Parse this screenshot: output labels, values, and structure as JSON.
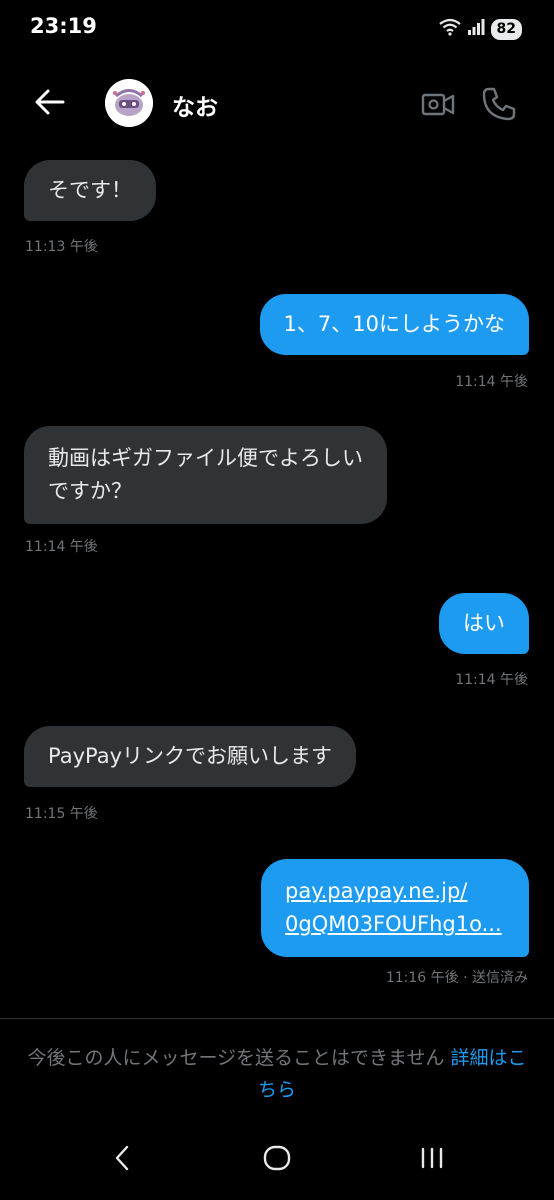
{
  "status_bar": {
    "time": "23:19",
    "battery": "82"
  },
  "header": {
    "contact_name": "なお"
  },
  "messages": [
    {
      "direction": "in",
      "text": "そです！",
      "time": "11:13 午後"
    },
    {
      "direction": "out",
      "text": "1、7、10にしようかな",
      "time": "11:14 午後"
    },
    {
      "direction": "in",
      "text_lines": [
        "動画はギガファイル便でよろしい",
        "ですか？"
      ],
      "time": "11:14 午後"
    },
    {
      "direction": "out",
      "text": "はい",
      "time": "11:14 午後"
    },
    {
      "direction": "in",
      "text": "PayPayリンクでお願いします",
      "time": "11:15 午後"
    },
    {
      "direction": "out",
      "link_lines": [
        "pay.paypay.ne.jp/",
        "0gQM03FOUFhg1o..."
      ],
      "time": "11:16 午後 · 送信済み"
    }
  ],
  "footer": {
    "notice_text": "今後この人にメッセージを送ることはできません",
    "notice_link": "詳細はこちら"
  },
  "colors": {
    "background": "#000000",
    "incoming_bubble": "#2f3336",
    "outgoing_bubble": "#1d9bf0",
    "timestamp": "#71767b",
    "accent": "#1d9bf0"
  },
  "icons": [
    "back-arrow-icon",
    "video-call-icon",
    "phone-icon",
    "wifi-icon",
    "signal-icon",
    "nav-back-icon",
    "nav-home-icon",
    "nav-recents-icon"
  ]
}
